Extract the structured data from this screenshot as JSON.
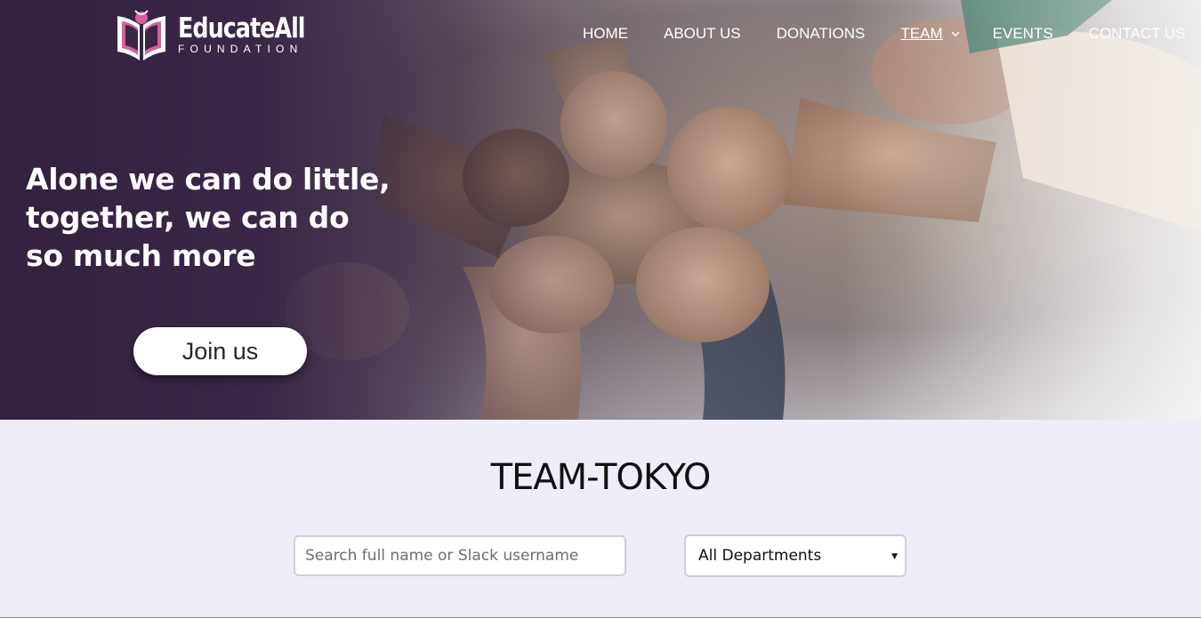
{
  "logo": {
    "name": "EducateAll",
    "sub": "FOUNDATION",
    "icon": "book-heart-logo"
  },
  "nav": {
    "items": [
      {
        "label": "HOME"
      },
      {
        "label": "ABOUT US"
      },
      {
        "label": "DONATIONS"
      },
      {
        "label": "TEAM",
        "active": true,
        "has_dropdown": true
      },
      {
        "label": "EVENTS"
      },
      {
        "label": "CONTACT US"
      }
    ]
  },
  "hero": {
    "tagline": "Alone we can do little,\ntogether, we can do\nso much more",
    "cta_label": "Join us"
  },
  "team": {
    "title": "TEAM-TOKYO",
    "search_placeholder": "Search full name or Slack username",
    "search_value": "",
    "department_selected": "All Departments"
  },
  "colors": {
    "hero_dark": "#32203f",
    "accent_pink": "#d6609a",
    "content_bg": "#eeedf8"
  }
}
